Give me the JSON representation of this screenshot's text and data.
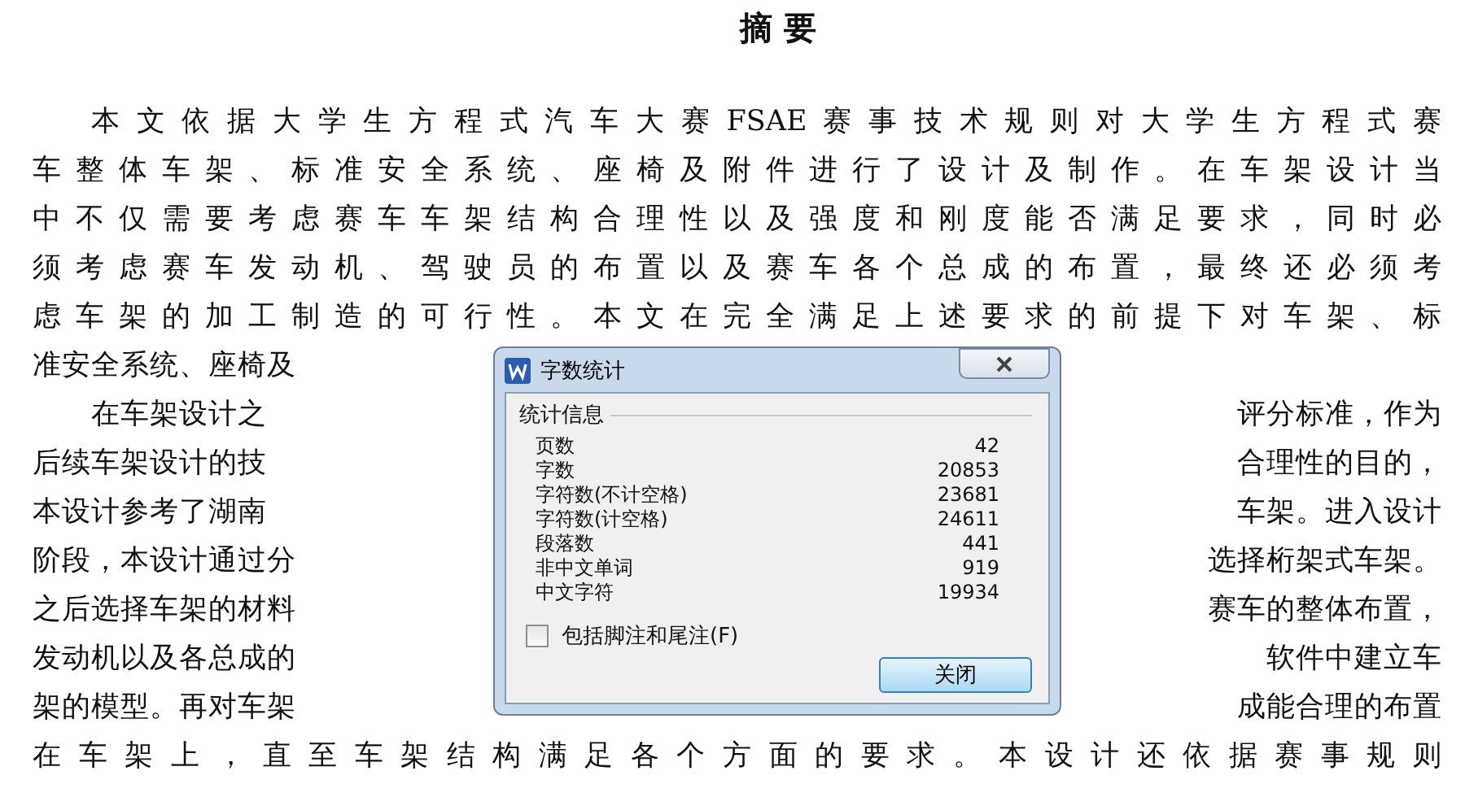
{
  "document": {
    "title": "摘 要",
    "paragraphs": [
      {
        "lines": [
          {
            "left": "本文依据大学生方程式汽车大赛FSAE赛事技术规则对大学生方程式赛"
          },
          {
            "left": "车整体车架、标准安全系统、座椅及附件进行了设计及制作。在车架设计当"
          },
          {
            "left": "中不仅需要考虑赛车车架结构合理性以及强度和刚度能否满足要求，同时必"
          },
          {
            "left": "须考虑赛车发动机、驾驶员的布置以及赛车各个总成的布置，最终还必须考"
          },
          {
            "left": "虑车架的加工制造的可行性。本文在完全满足上述要求的前提下对车架、标"
          },
          {
            "left": "准安全系统、座椅及"
          }
        ]
      },
      {
        "lines": [
          {
            "left": "在车架设计之",
            "right": "评分标准，作为"
          },
          {
            "left": "后续车架设计的技",
            "right": "合理性的目的，"
          },
          {
            "left": "本设计参考了湖南",
            "right": "车架。进入设计"
          },
          {
            "left": "阶段，本设计通过分",
            "right": "选择桁架式车架。"
          },
          {
            "left": "之后选择车架的材料",
            "right": "赛车的整体布置，"
          },
          {
            "left": "发动机以及各总成的",
            "right": "软件中建立车"
          },
          {
            "left": "架的模型。再对车架",
            "right": "成能合理的布置"
          },
          {
            "left": "在车架上，直至车架结构满足各个方面的要求。本设计还依据赛事规则"
          }
        ]
      }
    ]
  },
  "dialog": {
    "title": "字数统计",
    "group": "统计信息",
    "stats": [
      {
        "label": "页数",
        "value": "42"
      },
      {
        "label": "字数",
        "value": "20853"
      },
      {
        "label": "字符数(不计空格)",
        "value": "23681"
      },
      {
        "label": "字符数(计空格)",
        "value": "24611"
      },
      {
        "label": "段落数",
        "value": "441"
      },
      {
        "label": "非中文单词",
        "value": "919"
      },
      {
        "label": "中文字符",
        "value": "19934"
      }
    ],
    "checkbox": {
      "label": "包括脚注和尾注(F)",
      "checked": false
    },
    "button": "关闭"
  }
}
